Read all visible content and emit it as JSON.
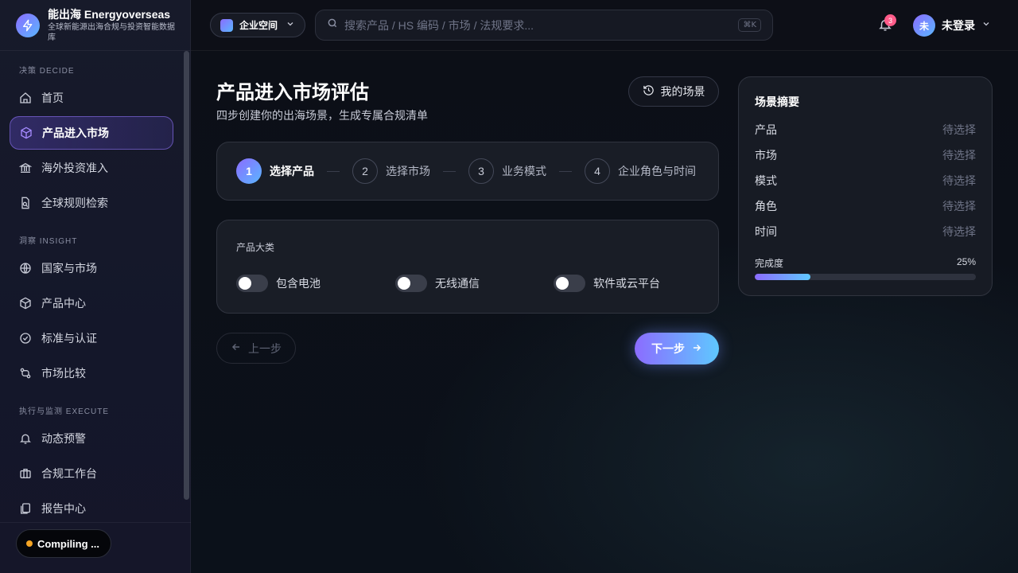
{
  "brand": {
    "title": "能出海 Energyoverseas",
    "subtitle": "全球新能源出海合规与投资智能数据库"
  },
  "sidebar": {
    "sections": [
      {
        "label": "决策 DECIDE",
        "items": [
          {
            "label": "首页",
            "icon": "home-icon"
          },
          {
            "label": "产品进入市场",
            "icon": "box-icon",
            "active": true
          },
          {
            "label": "海外投资准入",
            "icon": "bank-icon"
          },
          {
            "label": "全球规则检索",
            "icon": "doc-search-icon"
          }
        ]
      },
      {
        "label": "洞察 INSIGHT",
        "items": [
          {
            "label": "国家与市场",
            "icon": "globe-icon"
          },
          {
            "label": "产品中心",
            "icon": "cube-icon"
          },
          {
            "label": "标准与认证",
            "icon": "check-circle-icon"
          },
          {
            "label": "市场比较",
            "icon": "compare-icon"
          }
        ]
      },
      {
        "label": "执行与监测 EXECUTE",
        "items": [
          {
            "label": "动态预警",
            "icon": "bell-icon"
          },
          {
            "label": "合规工作台",
            "icon": "briefcase-icon"
          },
          {
            "label": "报告中心",
            "icon": "report-icon"
          }
        ]
      }
    ],
    "status": "Compiling ..."
  },
  "topbar": {
    "workspace": "企业空间",
    "search_placeholder": "搜索产品 / HS 编码 / 市场 / 法规要求...",
    "shortcut": "⌘K",
    "notifications": "3",
    "avatar_initial": "未",
    "user": "未登录"
  },
  "main": {
    "title": "产品进入市场评估",
    "subtitle": "四步创建你的出海场景，生成专属合规清单",
    "scenes_button": "我的场景",
    "steps": [
      {
        "num": "1",
        "label": "选择产品",
        "active": true
      },
      {
        "num": "2",
        "label": "选择市场"
      },
      {
        "num": "3",
        "label": "业务模式"
      },
      {
        "num": "4",
        "label": "企业角色与时间"
      }
    ],
    "category_title": "产品大类",
    "toggles": [
      {
        "label": "包含电池",
        "on": false
      },
      {
        "label": "无线通信",
        "on": false
      },
      {
        "label": "软件或云平台",
        "on": false
      }
    ],
    "prev_button": "上一步",
    "next_button": "下一步"
  },
  "summary": {
    "title": "场景摘要",
    "rows": [
      {
        "key": "产品",
        "value": "待选择"
      },
      {
        "key": "市场",
        "value": "待选择"
      },
      {
        "key": "模式",
        "value": "待选择"
      },
      {
        "key": "角色",
        "value": "待选择"
      },
      {
        "key": "时间",
        "value": "待选择"
      }
    ],
    "progress_label": "完成度",
    "progress_text": "25%",
    "progress_value": 0.25
  },
  "colors": {
    "accent_start": "#8b6cff",
    "accent_end": "#5fc8ff",
    "badge": "#ff5c8a",
    "status_dot": "#f5a524"
  }
}
